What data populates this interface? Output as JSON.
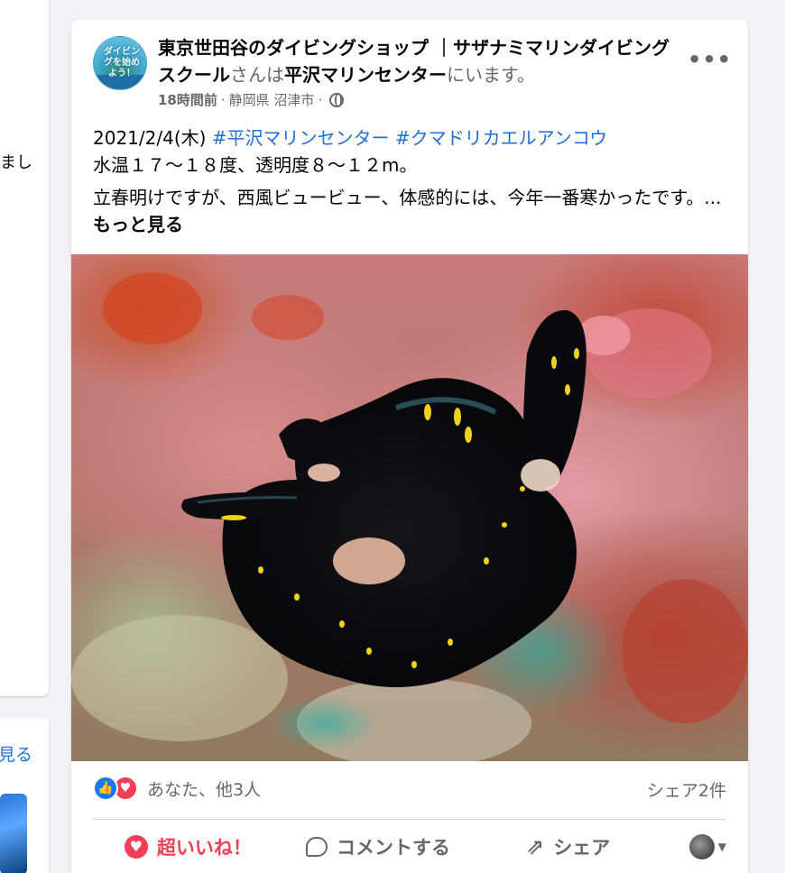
{
  "left_column": {
    "card1_fragment": "まし",
    "card2_fragment": "見る"
  },
  "post": {
    "avatar_text": "ダイビングを始めよう！",
    "page_name": "東京世田谷のダイビングショップ ｜サザナミマリンダイビングスクール",
    "is_at": "さんは",
    "location_name": "平沢マリンセンター",
    "at_suffix": "にいます。",
    "time": "18時間前",
    "place": "静岡県 沼津市",
    "dot": "·",
    "more_label": "•••",
    "date_text": "2021/2/4(木) ",
    "hashtag1": "#平沢マリンセンター",
    "hashtag2": "#クマドリカエルアンコウ",
    "water_line": "水温１７～１８度、透明度８～１２m。",
    "body_line": "立春明けですが、西風ビュービュー、体感的には、今年一番寒かったです。...",
    "see_more": "もっと見る",
    "reactions_text": "あなた、他3人",
    "share_count": "シェア2件",
    "actions": {
      "love": "超いいね！",
      "comment": "コメントする",
      "share": "シェア"
    },
    "colors": {
      "link_blue": "#216fdb",
      "love_red": "#f33e58",
      "like_blue": "#1877f2",
      "secondary_text": "#65676b"
    }
  }
}
